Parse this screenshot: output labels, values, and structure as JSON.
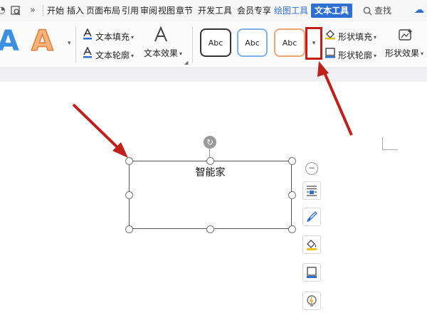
{
  "menubar": {
    "tabs": [
      {
        "label": "开始"
      },
      {
        "label": "插入"
      },
      {
        "label": "页面布局"
      },
      {
        "label": "引用"
      },
      {
        "label": "审阅"
      },
      {
        "label": "视图"
      },
      {
        "label": "章节"
      },
      {
        "label": "开发工具"
      },
      {
        "label": "会员专享"
      },
      {
        "label": "绘图工具"
      },
      {
        "label": "文本工具"
      }
    ],
    "search_label": "查找",
    "more_glyph": "»"
  },
  "ribbon": {
    "text_fill_label": "文本填充",
    "text_outline_label": "文本轮廓",
    "text_effect_label": "文本效果",
    "big_letter": "A",
    "style_samples": [
      "Abc",
      "Abc",
      "Abc"
    ],
    "shape_fill_label": "形状填充",
    "shape_outline_label": "形状轮廓",
    "shape_effect_label": "形状效果"
  },
  "document": {
    "textbox_text": "智能家"
  },
  "colors": {
    "accent": "#2f6fd1",
    "annotation_red": "#c0201c"
  }
}
